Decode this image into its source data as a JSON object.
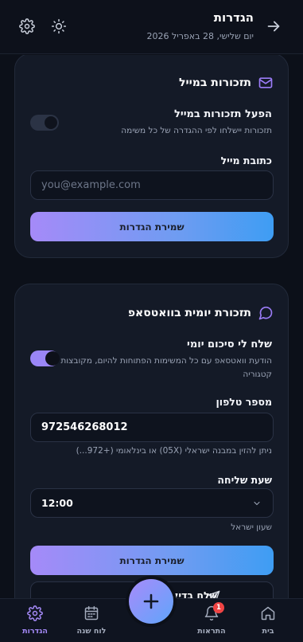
{
  "header": {
    "title": "הגדרות",
    "subtitle": "יום שלישי, 28 באפריל 2026",
    "icons": [
      "arrow-right-icon",
      "gear-icon",
      "sun-icon"
    ]
  },
  "email_card": {
    "title": "תזכורות במייל",
    "icon": "mail-icon",
    "enable_title": "הפעל תזכורות במייל",
    "enable_desc": "תזכורות יישלחו לפי ההגדרה של כל משימה",
    "enable_state": "off",
    "address_label": "כתובת מייל",
    "address_placeholder": "you@example.com",
    "save_label": "שמירת הגדרות"
  },
  "whatsapp_card": {
    "title": "תזכורת יומית בוואטסאפ",
    "icon": "chat-bubble-icon",
    "daily_title": "שלח לי סיכום יומי",
    "daily_desc": "הודעת וואטסאפ עם כל המשימות הפתוחות להיום, מקובצות לפי קטגוריה",
    "daily_state": "on",
    "phone_label": "מספר טלפון",
    "phone_value": "972546268012",
    "phone_hint": "ניתן להזין במבנה ישראלי (05X) או בינלאומי (+972...)",
    "time_label": "שעת שליחה",
    "time_value": "12:00",
    "timezone_hint": "שעון ישראל",
    "save_label": "שמירת הגדרות",
    "test_label": "שלח בדיקה עכשיו"
  },
  "bottom_nav": {
    "items": [
      {
        "label": "בית",
        "icon": "home-icon",
        "active": false
      },
      {
        "label": "התראות",
        "icon": "bell-icon",
        "active": false,
        "badge": "1"
      },
      {
        "label": "לוח שנה",
        "icon": "calendar-icon",
        "active": false
      },
      {
        "label": "הגדרות",
        "icon": "gear-icon",
        "active": true
      }
    ],
    "fab_icon": "plus-icon"
  },
  "colors": {
    "accent": "#a58af8",
    "accent_blue": "#3e9df3",
    "background": "#0c1019",
    "card": "#141a27",
    "badge": "#ef4444"
  }
}
